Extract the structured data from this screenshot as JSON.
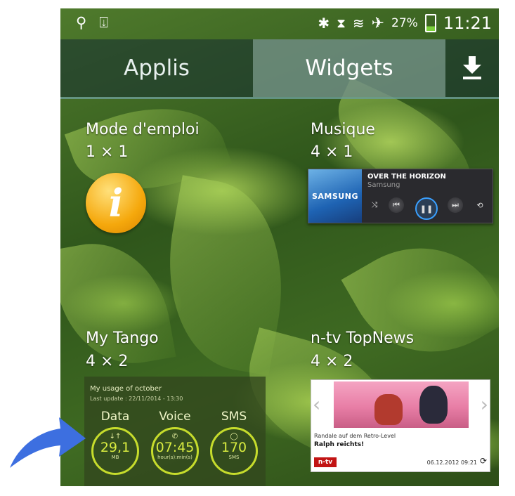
{
  "status_bar": {
    "left_icons": [
      "usb-icon",
      "download-done-icon"
    ],
    "right_icons": [
      "bluetooth-icon",
      "vibrate-icon",
      "wifi-icon",
      "airplane-icon"
    ],
    "battery": "27%",
    "time": "11:21"
  },
  "tabs": {
    "apps": "Applis",
    "widgets": "Widgets",
    "active": "Widgets",
    "download_icon": "download-icon"
  },
  "widgets": [
    {
      "name": "Mode d'emploi",
      "size": "1 × 1",
      "preview_icon": "info-icon"
    },
    {
      "name": "Musique",
      "size": "4 × 1",
      "preview": {
        "art_label": "SAMSUNG",
        "song": "OVER THE HORIZON",
        "artist": "Samsung"
      }
    },
    {
      "name": "My Tango",
      "size": "4 × 2",
      "preview": {
        "title": "My usage of october",
        "last_update": "Last update : 22/11/2014 - 13:30",
        "meters": [
          {
            "label": "Data",
            "icon": "↓↑",
            "value": "29,1",
            "unit": "MB"
          },
          {
            "label": "Voice",
            "icon": "✆",
            "value": "07:45",
            "unit": "hour(s):min(s)"
          },
          {
            "label": "SMS",
            "icon": "💬",
            "value": "170",
            "unit": "SMS"
          }
        ]
      }
    },
    {
      "name": "n-tv TopNews",
      "size": "4 × 2",
      "preview": {
        "kicker": "Randale auf dem Retro-Level",
        "headline": "Ralph reichts!",
        "logo": "n-tv",
        "date": "06.12.2012 09:21"
      }
    }
  ],
  "colors": {
    "accent": "#3aa0ff",
    "tango_ring": "#c6dc2c",
    "pointer_arrow": "#3d6fe0"
  }
}
